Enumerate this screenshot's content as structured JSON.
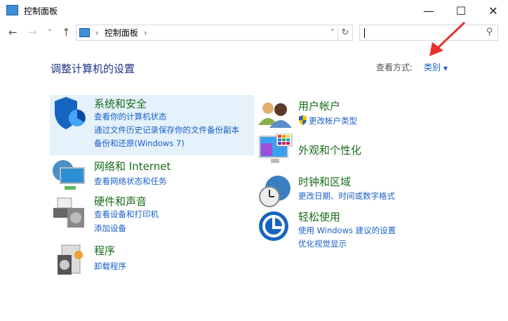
{
  "window": {
    "title": "控制面板",
    "minimize": "—",
    "maximize": "☐",
    "close": "✕"
  },
  "nav": {
    "back": "←",
    "forward": "→",
    "recent": "˅",
    "up": "↑",
    "breadcrumb": "控制面板",
    "sep": "›",
    "dropdown": "˅",
    "refresh": "↻",
    "search_placeholder": "",
    "search_icon": "⚲"
  },
  "main": {
    "heading": "调整计算机的设置",
    "view_by_label": "查看方式:",
    "view_by_value": "类别",
    "view_by_arrow": "▼"
  },
  "categories": [
    {
      "title": "系统和安全",
      "links": [
        "查看你的计算机状态",
        "通过文件历史记录保存你的文件备份副本",
        "备份和还原(Windows 7)"
      ]
    },
    {
      "title": "网络和 Internet",
      "links": [
        "查看网络状态和任务"
      ]
    },
    {
      "title": "硬件和声音",
      "links": [
        "查看设备和打印机",
        "添加设备"
      ]
    },
    {
      "title": "程序",
      "links": [
        "卸载程序"
      ]
    },
    {
      "title": "用户帐户",
      "links": [
        "更改帐户类型"
      ]
    },
    {
      "title": "外观和个性化",
      "links": []
    },
    {
      "title": "时钟和区域",
      "links": [
        "更改日期、时间或数字格式"
      ]
    },
    {
      "title": "轻松使用",
      "links": [
        "使用 Windows 建议的设置",
        "优化视觉显示"
      ]
    }
  ],
  "colors": {
    "title_green": "#1a6b1a",
    "link_blue": "#1a5fc9",
    "highlight": "#e5f1fb",
    "annotation_arrow": "#e8312f"
  }
}
